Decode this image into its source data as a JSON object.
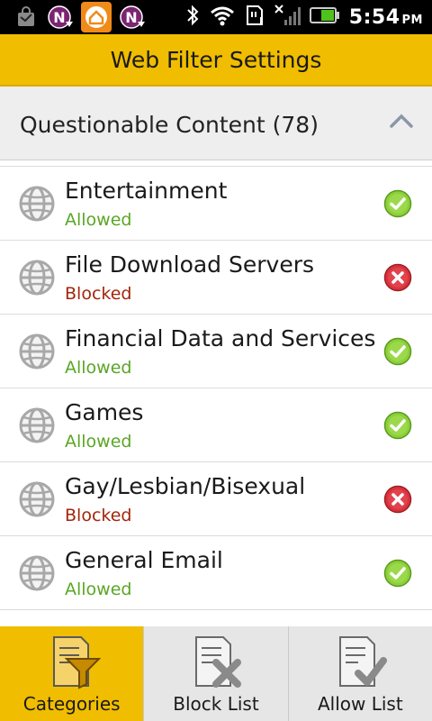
{
  "status_bar": {
    "time": "5:54",
    "ampm": "PM",
    "icons": [
      "shopping-bag-icon",
      "norton-n-icon",
      "home-app-icon",
      "norton-n-icon",
      "bluetooth-icon",
      "wifi-icon",
      "sd-card-icon",
      "no-signal-icon",
      "battery-icon"
    ]
  },
  "header": {
    "title": "Web Filter Settings"
  },
  "section": {
    "title": "Questionable Content (78)",
    "icon": "chevron-up-icon"
  },
  "categories": [
    {
      "name": "Entertainment",
      "status": "Allowed"
    },
    {
      "name": "File Download Servers",
      "status": "Blocked"
    },
    {
      "name": "Financial Data and Services",
      "status": "Allowed"
    },
    {
      "name": "Games",
      "status": "Allowed"
    },
    {
      "name": "Gay/Lesbian/Bisexual",
      "status": "Blocked"
    },
    {
      "name": "General Email",
      "status": "Allowed"
    }
  ],
  "tabs": [
    {
      "label": "Categories",
      "icon": "filter-document-icon",
      "active": true
    },
    {
      "label": "Block List",
      "icon": "document-x-icon",
      "active": false
    },
    {
      "label": "Allow List",
      "icon": "document-check-icon",
      "active": false
    }
  ],
  "colors": {
    "accent": "#f0bd00",
    "allowed": "#5aa625",
    "blocked": "#a3260a"
  }
}
